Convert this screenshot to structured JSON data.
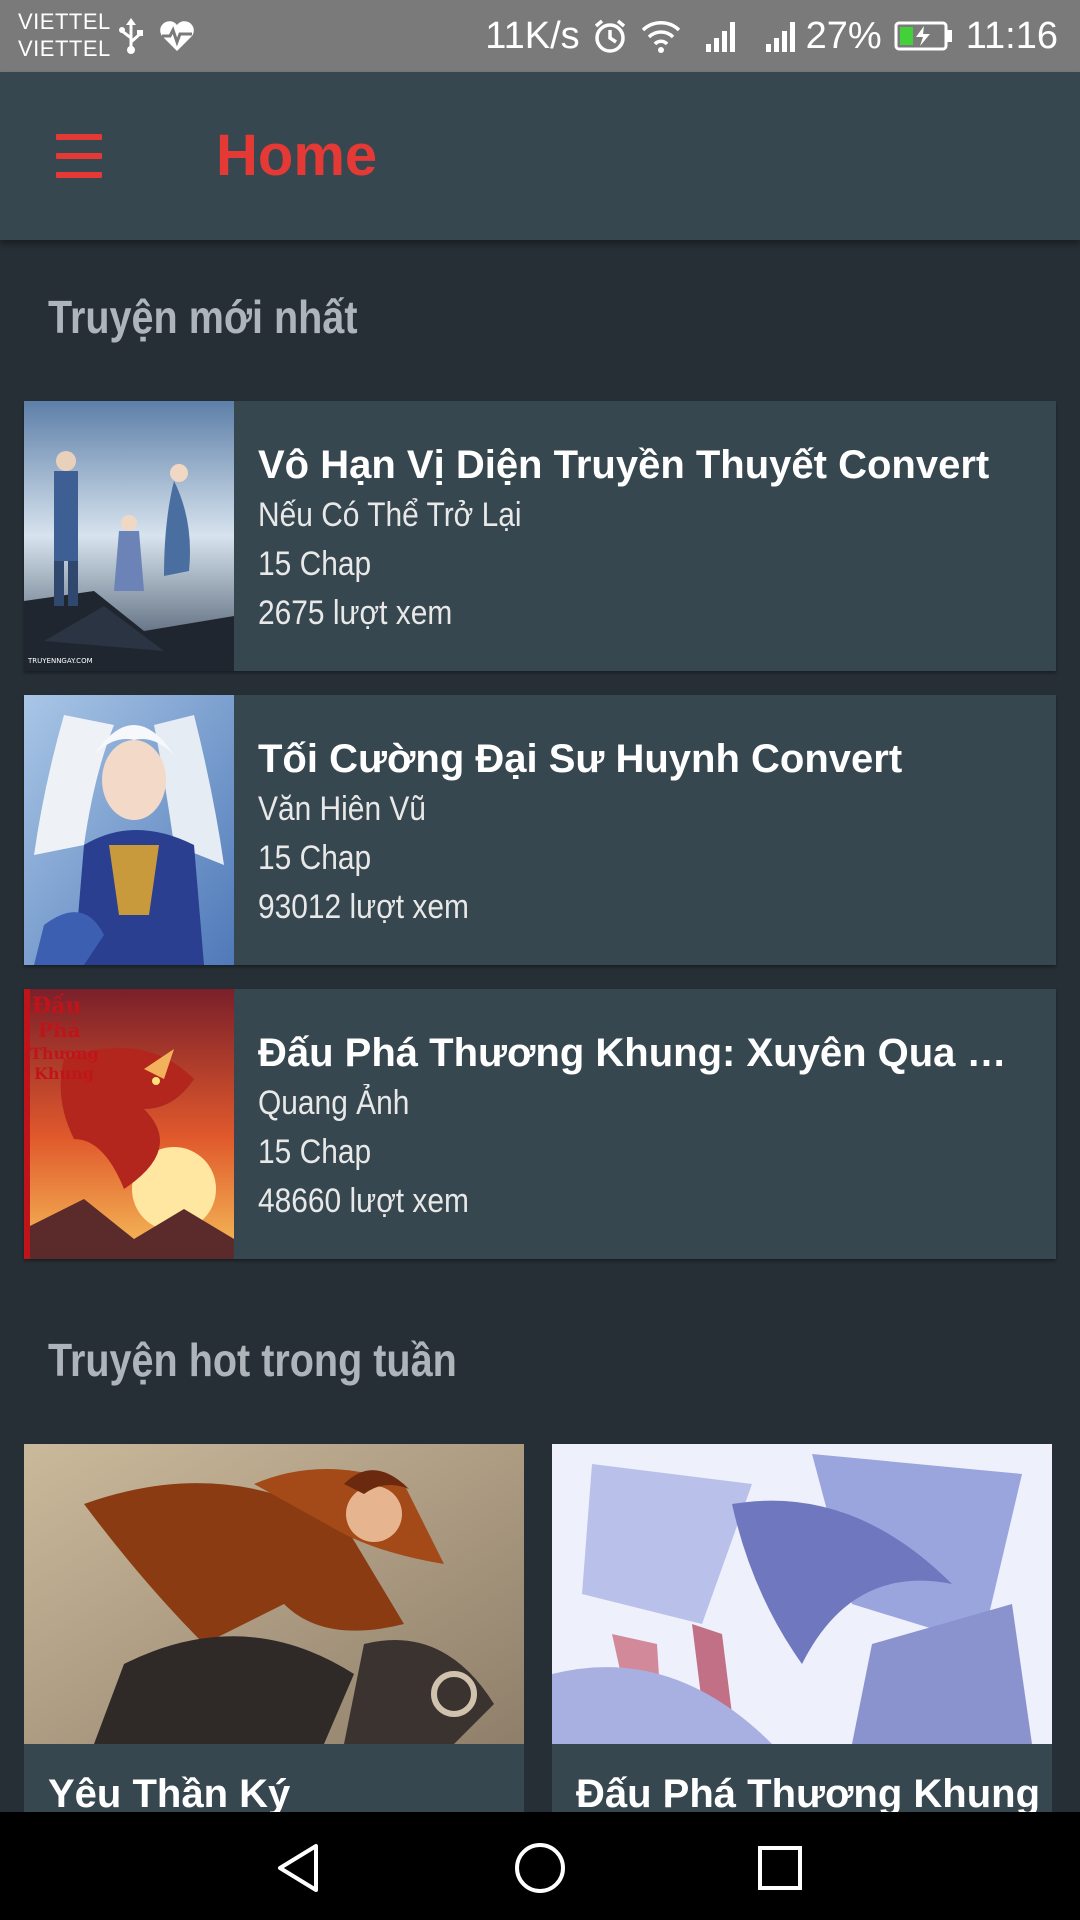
{
  "status_bar": {
    "carrier_1": "VIETTEL",
    "carrier_2": "VIETTEL",
    "net_speed": "11K/s",
    "battery_percent": "27%",
    "time": "11:16",
    "icons": [
      "usb-icon",
      "health-icon",
      "alarm-icon",
      "wifi-icon",
      "signal-icon",
      "signal-icon",
      "battery-charging-icon"
    ]
  },
  "app_bar": {
    "title": "Home",
    "menu_icon": "hamburger-menu-icon",
    "accent_color": "#e53935"
  },
  "latest_section": {
    "title": "Truyện mới nhất",
    "items": [
      {
        "title": "Vô Hạn Vị Diện Truyền Thuyết Convert",
        "author": "Nếu Có Thể Trở Lại",
        "chapters": "15 Chap",
        "views": "2675 lượt xem"
      },
      {
        "title": "Tối Cường Đại Sư Huynh Convert",
        "author": "Văn Hiên Vũ",
        "chapters": "15 Chap",
        "views": "93012 lượt xem"
      },
      {
        "title": "Đấu Phá Thương Khung: Xuyên Qua Lu...",
        "author": "Quang Ảnh",
        "chapters": "15 Chap",
        "views": "48660 lượt xem"
      }
    ]
  },
  "hot_section": {
    "title": "Truyện hot trong tuần",
    "items": [
      {
        "title": "Yêu Thần Ký"
      },
      {
        "title": "Đấu Phá Thương Khung"
      }
    ]
  },
  "nav_bar": {
    "icons": [
      "back-triangle-icon",
      "home-circle-icon",
      "recents-square-icon"
    ]
  },
  "colors": {
    "background": "#262f36",
    "card": "#37474f",
    "status_bar": "#7a7a7a",
    "section_title": "#aeb5ba"
  }
}
